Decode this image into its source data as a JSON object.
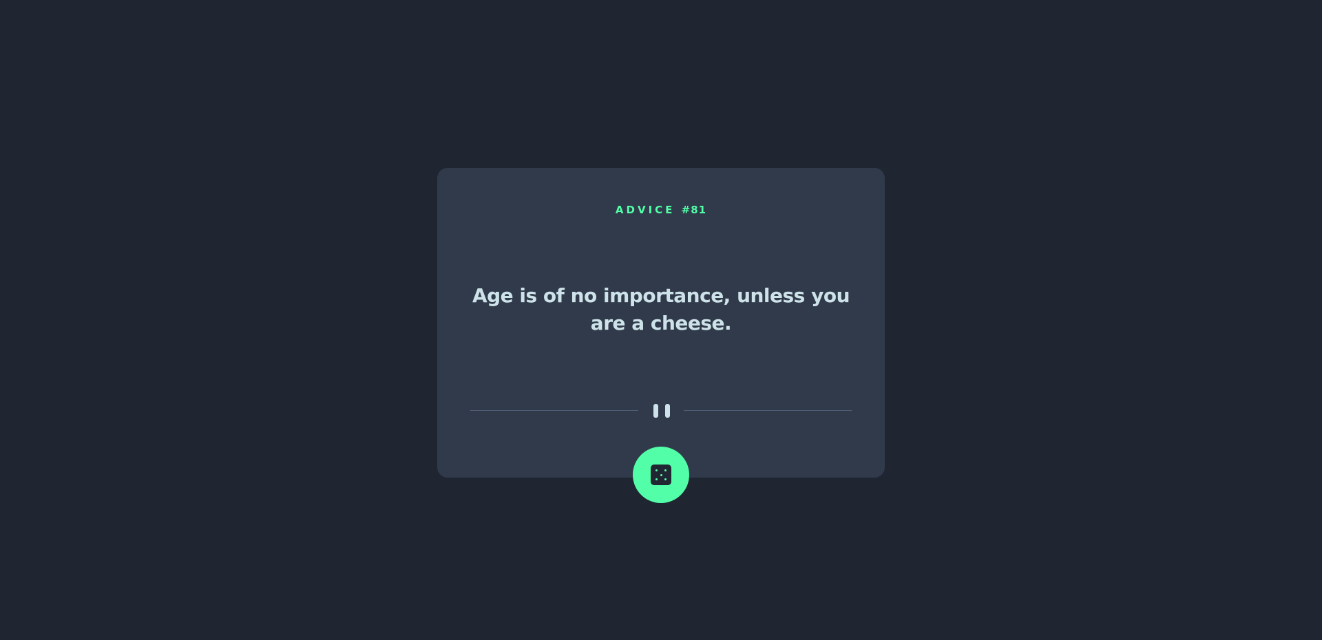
{
  "card": {
    "label_prefix": "ADVICE ",
    "advice_number": "#81",
    "quote": "Age is of no importance, unless you are a cheese."
  },
  "divider": {
    "icon": "pause-icon"
  },
  "dice_button": {
    "icon": "dice-icon"
  },
  "colors": {
    "background": "#1f2632",
    "card": "#313a4a",
    "accent": "#52ffa8",
    "text": "#cee3e9",
    "divider_line": "#4f5d74"
  }
}
